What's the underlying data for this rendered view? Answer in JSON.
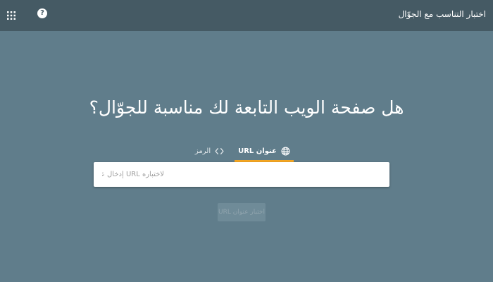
{
  "header": {
    "title": "اختبار التناسب مع الجوّال",
    "apps_icon": "apps-grid-icon",
    "help_icon": "help-circle-icon",
    "help_glyph": "?"
  },
  "main": {
    "headline": "هل صفحة الويب التابعة لك مناسبة للجوّال؟",
    "tabs": [
      {
        "label": "عنوان URL",
        "icon": "globe-icon",
        "active": true
      },
      {
        "label": "الرمز",
        "icon": "code-icon",
        "active": false
      }
    ],
    "url_input": {
      "placeholder": "لاختباره URL إدخال عنوان",
      "value": ""
    },
    "test_button_label": "اختبار عنوان URL"
  },
  "colors": {
    "topbar": "#455a64",
    "background": "#607d8b",
    "active_tab_indicator": "#f5a623"
  }
}
